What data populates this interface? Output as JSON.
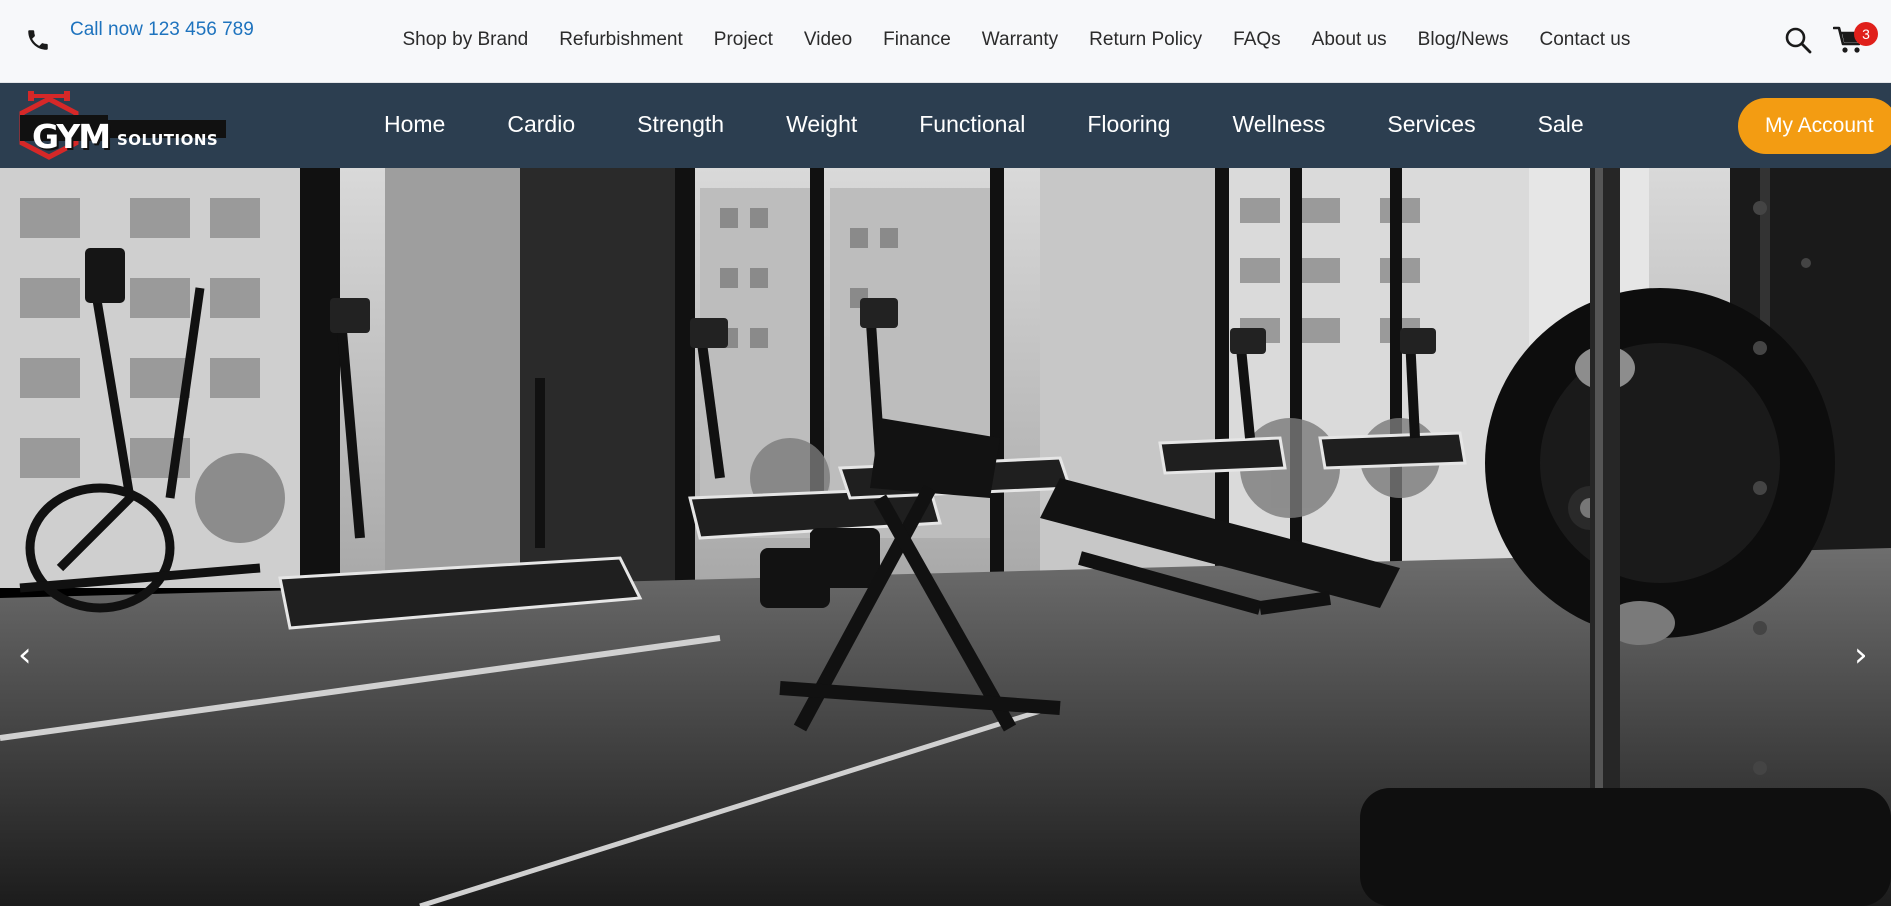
{
  "topbar": {
    "phone_icon": "phone-icon",
    "phone_label": "Call now 123 456 789",
    "links": [
      "Shop by Brand",
      "Refurbishment",
      "Project",
      "Video",
      "Finance",
      "Warranty",
      "Return Policy",
      "FAQs",
      "About us",
      "Blog/News",
      "Contact us"
    ],
    "search_icon": "search-icon",
    "cart_icon": "cart-icon",
    "cart_count": "3"
  },
  "mainnav": {
    "logo_gym": "GYM",
    "logo_solutions": "SOLUTIONS",
    "links": [
      "Home",
      "Cardio",
      "Strength",
      "Weight",
      "Functional",
      "Flooring",
      "Wellness",
      "Services",
      "Sale"
    ],
    "account_label": "My Account"
  },
  "hero": {
    "prev_label": "‹",
    "next_label": "›"
  },
  "colors": {
    "topbar_bg": "#f7f8fa",
    "phone_link": "#1e73be",
    "mainnav_bg": "#2c3e50",
    "account_btn": "#f39c12",
    "cart_badge": "#e0201b",
    "logo_red": "#d62828"
  }
}
